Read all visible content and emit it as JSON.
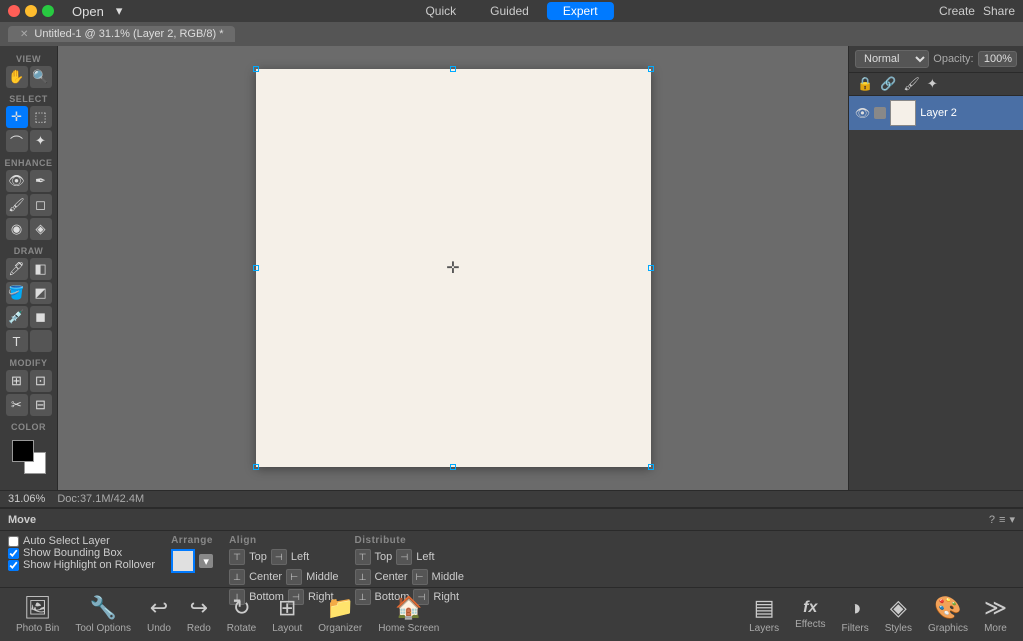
{
  "titlebar": {
    "open_label": "Open",
    "open_arrow": "▾",
    "tabs": [
      {
        "id": "quick",
        "label": "Quick",
        "active": false
      },
      {
        "id": "guided",
        "label": "Guided",
        "active": false
      },
      {
        "id": "expert",
        "label": "Expert",
        "active": true
      }
    ],
    "create_label": "Create",
    "share_label": "Share"
  },
  "doctab": {
    "close": "✕",
    "title": "Untitled-1 @ 31.1% (Layer 2, RGB/8) *"
  },
  "toolbar": {
    "view_label": "VIEW",
    "select_label": "SELECT",
    "enhance_label": "ENHANCE",
    "draw_label": "DRAW",
    "modify_label": "MODIFY",
    "color_label": "COLOR"
  },
  "layers_panel": {
    "blend_mode": "Normal",
    "opacity_label": "Opacity:",
    "opacity_value": "100%",
    "layer_name": "Layer 2"
  },
  "status": {
    "zoom": "31.06%",
    "doc_label": "Doc:",
    "doc_size": "37.1M/42.4M"
  },
  "options": {
    "move_label": "Move",
    "help_icon": "?",
    "menu_icon": "≡",
    "auto_select": "Auto Select Layer",
    "show_bounding": "Show Bounding Box",
    "show_highlight": "Show Highlight on Rollover",
    "arrange_label": "Arrange",
    "align_label": "Align",
    "distribute_label": "Distribute",
    "align_items": [
      {
        "label": "Top"
      },
      {
        "label": "Center"
      },
      {
        "label": "Bottom"
      }
    ],
    "align_items2": [
      {
        "label": "Left"
      },
      {
        "label": "Middle"
      },
      {
        "label": "Right"
      }
    ],
    "dist_items": [
      {
        "label": "Top"
      },
      {
        "label": "Center"
      },
      {
        "label": "Bottom"
      }
    ],
    "dist_items2": [
      {
        "label": "Left"
      },
      {
        "label": "Middle"
      },
      {
        "label": "Right"
      }
    ]
  },
  "bottom_toolbar": {
    "items": [
      {
        "id": "photo-bin",
        "icon": "🖼",
        "label": "Photo Bin"
      },
      {
        "id": "tool-options",
        "icon": "🔧",
        "label": "Tool Options"
      },
      {
        "id": "undo",
        "icon": "↩",
        "label": "Undo"
      },
      {
        "id": "redo",
        "icon": "↪",
        "label": "Redo"
      },
      {
        "id": "rotate",
        "icon": "↻",
        "label": "Rotate"
      },
      {
        "id": "layout",
        "icon": "⊞",
        "label": "Layout"
      },
      {
        "id": "organizer",
        "icon": "📁",
        "label": "Organizer"
      },
      {
        "id": "home-screen",
        "icon": "🏠",
        "label": "Home Screen"
      }
    ],
    "right_items": [
      {
        "id": "layers",
        "icon": "▤",
        "label": "Layers"
      },
      {
        "id": "effects",
        "icon": "fx",
        "label": "Effects"
      },
      {
        "id": "filters",
        "icon": "◑",
        "label": "Filters"
      },
      {
        "id": "styles",
        "icon": "◈",
        "label": "Styles"
      },
      {
        "id": "graphics",
        "icon": "🎨",
        "label": "Graphics"
      },
      {
        "id": "more",
        "icon": "≫",
        "label": "More"
      }
    ]
  }
}
